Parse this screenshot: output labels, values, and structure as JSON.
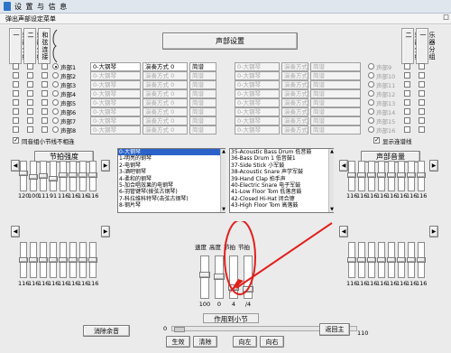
{
  "app": {
    "menu": "设 置 与 信 息",
    "dialog_title": "弹出声部设定菜单",
    "window_button": "□"
  },
  "left_group": {
    "headers": [
      "乐器分组一",
      "乐器分组二"
    ],
    "connector_label": "和弦连接"
  },
  "right_group": {
    "headers": [
      "乐器分组二",
      "乐器分组一"
    ]
  },
  "voice_setup_button": "声部设置",
  "voices_left": [
    {
      "name": "声部1",
      "selected": true,
      "instrument": "0-大钢琴",
      "mode": "演奏方式 0",
      "effect": "简谱",
      "active": true
    },
    {
      "name": "声部2",
      "selected": false,
      "instrument": "0-大钢琴",
      "mode": "演奏方式 0",
      "effect": "简谱",
      "active": false
    },
    {
      "name": "声部3",
      "selected": false,
      "instrument": "0-大钢琴",
      "mode": "演奏方式 0",
      "effect": "简谱",
      "active": false
    },
    {
      "name": "声部4",
      "selected": false,
      "instrument": "0-大钢琴",
      "mode": "演奏方式 0",
      "effect": "简谱",
      "active": false
    },
    {
      "name": "声部5",
      "selected": false,
      "instrument": "0-大钢琴",
      "mode": "演奏方式 0",
      "effect": "简谱",
      "active": false
    },
    {
      "name": "声部6",
      "selected": false,
      "instrument": "0-大钢琴",
      "mode": "演奏方式 0",
      "effect": "简谱",
      "active": false
    },
    {
      "name": "声部7",
      "selected": false,
      "instrument": "0-大钢琴",
      "mode": "演奏方式 0",
      "effect": "简谱",
      "active": false
    },
    {
      "name": "声部8",
      "selected": false,
      "instrument": "0-大钢琴",
      "mode": "演奏方式 0",
      "effect": "简谱",
      "active": false
    }
  ],
  "voices_right": [
    {
      "name": "声部9",
      "instrument": "0-大钢琴",
      "mode": "演奏方式 0",
      "effect": "简谱"
    },
    {
      "name": "声部10",
      "instrument": "0-大钢琴",
      "mode": "演奏方式 0",
      "effect": "简谱"
    },
    {
      "name": "声部11",
      "instrument": "0-大钢琴",
      "mode": "演奏方式 0",
      "effect": "简谱"
    },
    {
      "name": "声部12",
      "instrument": "0-大钢琴",
      "mode": "演奏方式 0",
      "effect": "简谱"
    },
    {
      "name": "声部13",
      "instrument": "0-大钢琴",
      "mode": "演奏方式 0",
      "effect": "简谱"
    },
    {
      "name": "声部14",
      "instrument": "0-大钢琴",
      "mode": "演奏方式 0",
      "effect": "简谱"
    },
    {
      "name": "声部15",
      "instrument": "0-大钢琴",
      "mode": "演奏方式 0",
      "effect": "简谱"
    },
    {
      "name": "声部16",
      "instrument": "0-大钢琴",
      "mode": "演奏方式 0",
      "effect": "简谱"
    }
  ],
  "options": {
    "same_voice_bars": "同音组小节线不相连",
    "same_voice_bars_checked": true,
    "show_ties": "显示连谱线",
    "show_ties_checked": true
  },
  "tempo_panel": {
    "title": "节拍强度",
    "top_values": [
      "120",
      "100",
      "111",
      "91",
      "116",
      "116",
      "116",
      "116"
    ],
    "levels": [
      0.6,
      0.45,
      0.5,
      0.4,
      0.55,
      0.55,
      0.55,
      0.55
    ],
    "bottom_values": [
      "116",
      "116",
      "116",
      "116",
      "116",
      "116",
      "116",
      "116"
    ]
  },
  "volume_panel": {
    "title": "声部音量",
    "top_values": [
      "116",
      "116",
      "116",
      "116",
      "116",
      "116",
      "116",
      "116"
    ],
    "bottom_values": [
      "116",
      "116",
      "116",
      "116",
      "116",
      "116",
      "116",
      "116"
    ]
  },
  "instrument_list": [
    "0-大钢琴",
    "1-明亮的钢琴",
    "2-电钢琴",
    "3-酒吧钢琴",
    "4-柔和的钢琴",
    "5-加合唱效果的电钢琴",
    "6-羽管键琴(拨弦古钢琴)",
    "7-科拉维科特琴(击弦古钢琴)",
    "8-钢片琴"
  ],
  "percussion_list": [
    "35-Acoustic Bass Drum 低音鼓",
    "36-Bass Drum 1 低音鼓1",
    "37-Side Stick 小军鼓",
    "38-Acoustic Snare 声学军鼓",
    "39-Hand Clap 拍手声",
    "40-Electric Snare 电子军鼓",
    "41-Low Floor Tom 低落音鼓",
    "42-Closed Hi-Hat 闭合镲",
    "43-High Floor Tom 高落鼓"
  ],
  "speed_panel": {
    "labels": [
      "速度",
      "高度",
      "节拍",
      "节拍"
    ],
    "values": [
      "100",
      "0",
      "4",
      "/4"
    ],
    "levels": [
      0.55,
      0.5,
      0.2,
      0.15
    ]
  },
  "scope_label": "作用到小节",
  "scope_value": "0",
  "scope_max": "110",
  "buttons": {
    "clear_echo": "消除余音",
    "apply": "生效",
    "clear": "清除",
    "left": "向左",
    "right": "向右",
    "back": "返回主"
  }
}
